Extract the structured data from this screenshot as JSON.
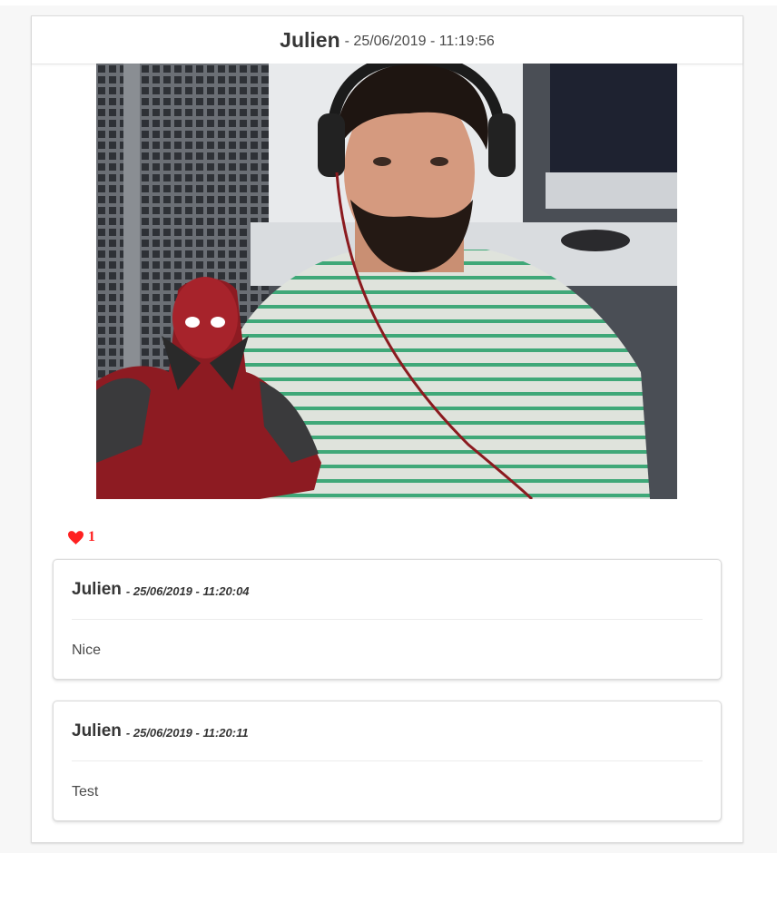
{
  "post": {
    "author": "Julien",
    "date": "- 25/06/2019 - 11:19:56",
    "likes": "1",
    "heart_icon": "heart-icon",
    "like_color": "#ff2020"
  },
  "comments": [
    {
      "author": "Julien",
      "date": "- 25/06/2019 - 11:20:04",
      "text": "Nice"
    },
    {
      "author": "Julien",
      "date": "- 25/06/2019 - 11:20:11",
      "text": "Test"
    }
  ]
}
